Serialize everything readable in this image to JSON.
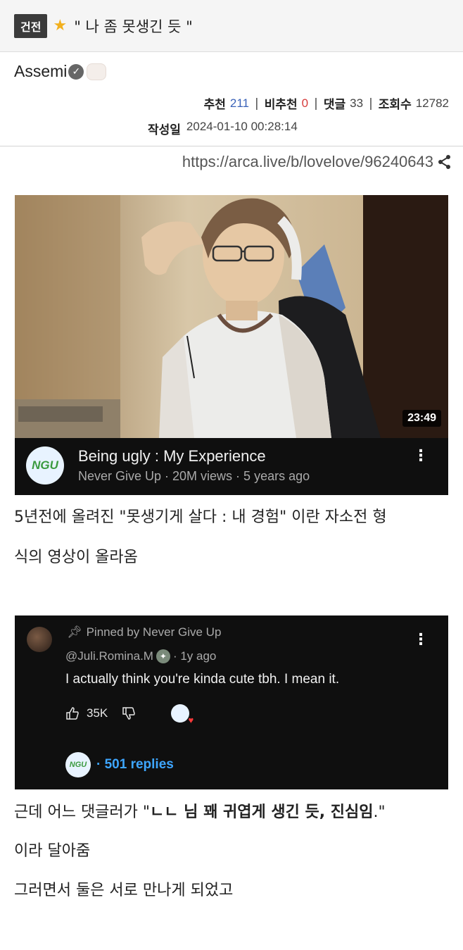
{
  "post": {
    "category_badge": "건전",
    "title": "\" 나 좀 못생긴 듯 \"",
    "author": "Assemi",
    "stats": {
      "upvote_label": "추천",
      "upvote_value": "211",
      "downvote_label": "비추천",
      "downvote_value": "0",
      "comment_label": "댓글",
      "comment_value": "33",
      "views_label": "조회수",
      "views_value": "12782"
    },
    "date_label": "작성일",
    "date_value": "2024-01-10 00:28:14",
    "url": "https://arca.live/b/lovelove/96240643"
  },
  "video": {
    "duration": "23:49",
    "title": "Being ugly : My Experience",
    "meta": "Never Give Up · 20M views · 5 years ago",
    "channel_logo": "NGU"
  },
  "body": {
    "paragraph1": "5년전에 올려진 \"못생기게 살다 : 내 경험\" 이란 자소전 형",
    "paragraph2": "식의 영상이 올라옴",
    "paragraph3_prefix": "근데 어느 댓글러가 \"",
    "paragraph3_bold": "ㄴㄴ 님 꽤 귀엽게 생긴 듯, 진심임",
    "paragraph3_suffix": ".\"",
    "paragraph4": "이라 달아줌",
    "paragraph5": "그러면서 둘은 서로 만나게 되었고"
  },
  "comment": {
    "pinned": "Pinned by Never Give Up",
    "handle": "@Juli.Romina.M",
    "age": "· 1y ago",
    "text": "I actually think you're kinda cute tbh. I mean it.",
    "likes": "35K",
    "replies": "· 501 replies"
  },
  "colors": {
    "accent_blue": "#3ea6ff",
    "star": "#f2b01e",
    "upvote": "#3a62b8",
    "downvote": "#d63b3b"
  }
}
